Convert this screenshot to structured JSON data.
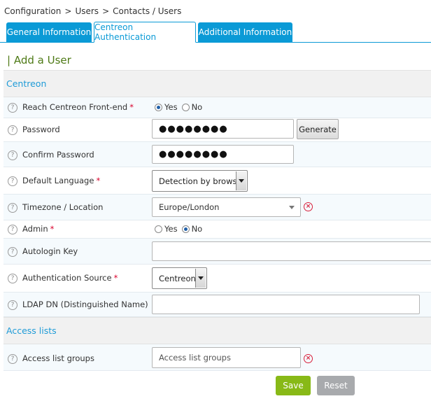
{
  "breadcrumb": {
    "items": [
      "Configuration",
      "Users",
      "Contacts / Users"
    ],
    "separator": ">"
  },
  "tabs": [
    {
      "label": "General Information",
      "active": false
    },
    {
      "label": "Centreon Authentication",
      "active": true
    },
    {
      "label": "Additional Information",
      "active": false
    }
  ],
  "page_title": "| Add a User",
  "sections": {
    "centreon": "Centreon",
    "access": "Access lists"
  },
  "form": {
    "reach_frontend": {
      "label": "Reach Centreon Front-end",
      "required": "*",
      "yes": "Yes",
      "no": "No",
      "selected": "yes"
    },
    "password": {
      "label": "Password",
      "value": "●●●●●●●●",
      "generate_label": "Generate"
    },
    "confirm_password": {
      "label": "Confirm Password",
      "value": "●●●●●●●●"
    },
    "default_language": {
      "label": "Default Language",
      "required": "*",
      "value": "Detection by browser"
    },
    "timezone": {
      "label": "Timezone / Location",
      "value": "Europe/London"
    },
    "admin": {
      "label": "Admin",
      "required": "*",
      "yes": "Yes",
      "no": "No",
      "selected": "no"
    },
    "autologin_key": {
      "label": "Autologin Key",
      "value": ""
    },
    "auth_source": {
      "label": "Authentication Source",
      "required": "*",
      "value": "Centreon"
    },
    "ldap_dn": {
      "label": "LDAP DN (Distinguished Name)",
      "value": ""
    },
    "access_list_groups": {
      "label": "Access list groups",
      "placeholder": "Access list groups"
    }
  },
  "help_glyph": "?",
  "clear_glyph": "×",
  "buttons": {
    "save": "Save",
    "reset": "Reset"
  },
  "colors": {
    "accent": "#0a9ad6",
    "title": "#4e7a16",
    "save": "#88b917",
    "reset": "#a8aaad",
    "required": "#d9002b",
    "clear": "#d81e3a"
  },
  "icons": {
    "help": "help-question-icon",
    "clear": "clear-circle-x-icon",
    "dropdown": "chevron-down-icon"
  }
}
